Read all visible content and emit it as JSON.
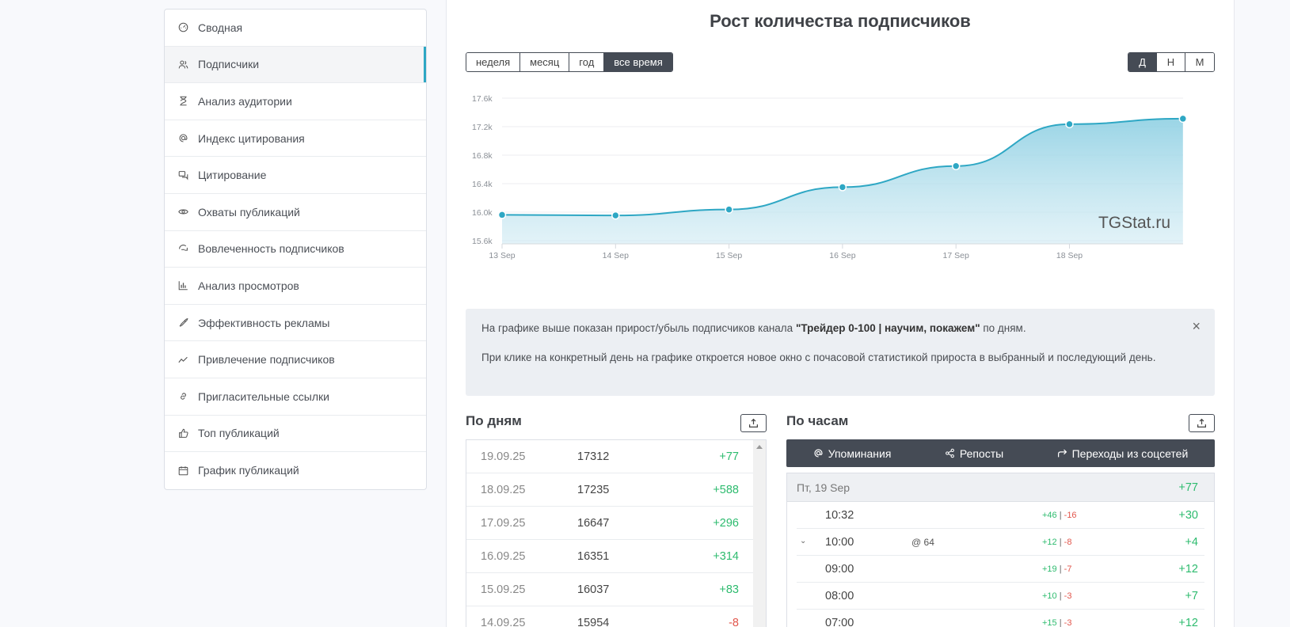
{
  "sidebar": {
    "items": [
      {
        "label": "Сводная",
        "icon": "dashboard-icon"
      },
      {
        "label": "Подписчики",
        "icon": "users-icon",
        "active": true
      },
      {
        "label": "Анализ аудитории",
        "icon": "hourglass-icon"
      },
      {
        "label": "Индекс цитирования",
        "icon": "at-icon"
      },
      {
        "label": "Цитирование",
        "icon": "quote-icon"
      },
      {
        "label": "Охваты публикаций",
        "icon": "eye-icon"
      },
      {
        "label": "Вовлеченность подписчиков",
        "icon": "engagement-icon"
      },
      {
        "label": "Анализ просмотров",
        "icon": "bar-chart-icon"
      },
      {
        "label": "Эффективность рекламы",
        "icon": "rocket-icon"
      },
      {
        "label": "Привлечение подписчиков",
        "icon": "trend-icon"
      },
      {
        "label": "Пригласительные ссылки",
        "icon": "link-icon"
      },
      {
        "label": "Топ публикаций",
        "icon": "thumbs-up-icon"
      },
      {
        "label": "График публикаций",
        "icon": "calendar-icon"
      }
    ]
  },
  "main": {
    "title": "Рост количества подписчиков",
    "period_buttons": [
      {
        "label": "неделя"
      },
      {
        "label": "месяц"
      },
      {
        "label": "год"
      },
      {
        "label": "все время",
        "active": true
      }
    ],
    "granularity_buttons": [
      {
        "label": "Д",
        "active": true
      },
      {
        "label": "Н"
      },
      {
        "label": "М"
      }
    ],
    "watermark": "TGStat.ru"
  },
  "chart_data": {
    "type": "area",
    "title": "Рост количества подписчиков",
    "x": [
      "13 Sep",
      "14 Sep",
      "15 Sep",
      "16 Sep",
      "17 Sep",
      "18 Sep",
      "19 Sep"
    ],
    "x_tick_labels": [
      "13 Sep",
      "14 Sep",
      "15 Sep",
      "16 Sep",
      "17 Sep",
      "18 Sep"
    ],
    "series": [
      {
        "values": [
          15962,
          15954,
          16037,
          16351,
          16647,
          17235,
          17312
        ]
      }
    ],
    "y_ticks": [
      "15.6k",
      "16.0k",
      "16.4k",
      "16.8k",
      "17.2k",
      "17.6k"
    ],
    "ylim": [
      15600,
      17600
    ],
    "grid": true,
    "color": "#2ea7c4"
  },
  "info": {
    "line1_pre": "На графике выше показан прирост/убыль подписчиков канала ",
    "channel": "\"Трейдер 0-100 | научим, покажем\"",
    "line1_post": " по дням.",
    "line2": "При клике на конкретный день на графике откроется новое окно с почасовой статистикой прироста в выбранный и последующий день.",
    "close": "×"
  },
  "by_days": {
    "title": "По дням",
    "rows": [
      {
        "date": "19.09.25",
        "value": "17312",
        "delta": "+77",
        "sign": "pos"
      },
      {
        "date": "18.09.25",
        "value": "17235",
        "delta": "+588",
        "sign": "pos"
      },
      {
        "date": "17.09.25",
        "value": "16647",
        "delta": "+296",
        "sign": "pos"
      },
      {
        "date": "16.09.25",
        "value": "16351",
        "delta": "+314",
        "sign": "pos"
      },
      {
        "date": "15.09.25",
        "value": "16037",
        "delta": "+83",
        "sign": "pos"
      },
      {
        "date": "14.09.25",
        "value": "15954",
        "delta": "-8",
        "sign": "neg"
      }
    ]
  },
  "by_hours": {
    "title": "По часам",
    "tabs": [
      {
        "label": "Упоминания",
        "icon": "at-icon"
      },
      {
        "label": "Репосты",
        "icon": "share-icon"
      },
      {
        "label": "Переходы из соцсетей",
        "icon": "redirect-icon"
      }
    ],
    "day_header": {
      "label": "Пт, 19 Sep",
      "delta": "+77"
    },
    "rows": [
      {
        "time": "10:32",
        "mentions": "",
        "in": "+46",
        "out": "-16",
        "delta": "+30",
        "expand": false
      },
      {
        "time": "10:00",
        "mentions": "@ 64",
        "in": "+12",
        "out": "-8",
        "delta": "+4",
        "expand": true
      },
      {
        "time": "09:00",
        "mentions": "",
        "in": "+19",
        "out": "-7",
        "delta": "+12",
        "expand": false
      },
      {
        "time": "08:00",
        "mentions": "",
        "in": "+10",
        "out": "-3",
        "delta": "+7",
        "expand": false
      },
      {
        "time": "07:00",
        "mentions": "",
        "in": "+15",
        "out": "-3",
        "delta": "+12",
        "expand": false
      }
    ]
  }
}
